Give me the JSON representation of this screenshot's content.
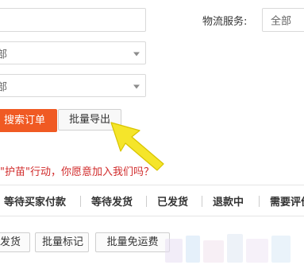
{
  "filters": {
    "field1_value": "",
    "select2_value": "全部",
    "select3_value": "全部",
    "logistics_label": "物流服务:",
    "logistics_value": "全部"
  },
  "buttons": {
    "search_label": "搜索订单",
    "export_label": "批量导出"
  },
  "promo": {
    "text": "\"护苗\"行动，你愿意加入我们吗？"
  },
  "tabs": [
    {
      "label": "等待买家付款"
    },
    {
      "label": "等待发货"
    },
    {
      "label": "已发货"
    },
    {
      "label": "退款中"
    },
    {
      "label": "需要评价"
    }
  ],
  "bottom_buttons": [
    {
      "label": "发货"
    },
    {
      "label": "批量标记"
    },
    {
      "label": "批量免运费"
    }
  ],
  "annotation": {
    "arrow_color": "#f5e52a",
    "arrow_outline": "#d8c400"
  },
  "colors": {
    "search_button_bg": "#f05a23",
    "promo_text": "#d12b2b"
  }
}
